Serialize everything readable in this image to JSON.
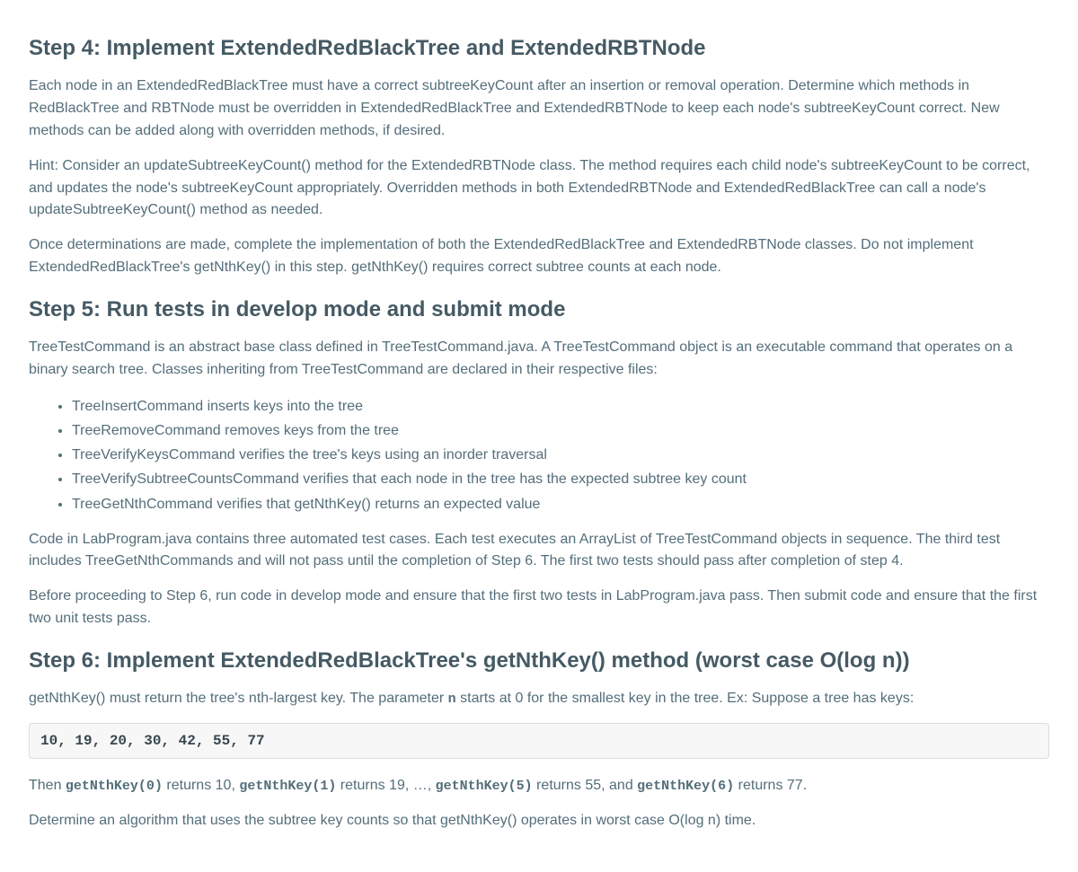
{
  "step4": {
    "heading": "Step 4: Implement ExtendedRedBlackTree and ExtendedRBTNode",
    "p1": "Each node in an ExtendedRedBlackTree must have a correct subtreeKeyCount after an insertion or removal operation. Determine which methods in RedBlackTree and RBTNode must be overridden in ExtendedRedBlackTree and ExtendedRBTNode to keep each node's subtreeKeyCount correct. New methods can be added along with overridden methods, if desired.",
    "p2": "Hint: Consider an updateSubtreeKeyCount() method for the ExtendedRBTNode class. The method requires each child node's subtreeKeyCount to be correct, and updates the node's subtreeKeyCount appropriately. Overridden methods in both ExtendedRBTNode and ExtendedRedBlackTree can call a node's updateSubtreeKeyCount() method as needed.",
    "p3": "Once determinations are made, complete the implementation of both the ExtendedRedBlackTree and ExtendedRBTNode classes. Do not implement ExtendedRedBlackTree's getNthKey() in this step. getNthKey() requires correct subtree counts at each node."
  },
  "step5": {
    "heading": "Step 5: Run tests in develop mode and submit mode",
    "p1": "TreeTestCommand is an abstract base class defined in TreeTestCommand.java. A TreeTestCommand object is an executable command that operates on a binary search tree. Classes inheriting from TreeTestCommand are declared in their respective files:",
    "bullets": [
      "TreeInsertCommand inserts keys into the tree",
      "TreeRemoveCommand removes keys from the tree",
      "TreeVerifyKeysCommand verifies the tree's keys using an inorder traversal",
      "TreeVerifySubtreeCountsCommand verifies that each node in the tree has the expected subtree key count",
      "TreeGetNthCommand verifies that getNthKey() returns an expected value"
    ],
    "p2": "Code in LabProgram.java contains three automated test cases. Each test executes an ArrayList of TreeTestCommand objects in sequence. The third test includes TreeGetNthCommands and will not pass until the completion of Step 6. The first two tests should pass after completion of step 4.",
    "p3": "Before proceeding to Step 6, run code in develop mode and ensure that the first two tests in LabProgram.java pass. Then submit code and ensure that the first two unit tests pass."
  },
  "step6": {
    "heading": "Step 6: Implement ExtendedRedBlackTree's getNthKey() method (worst case O(log n))",
    "p1_pre": "getNthKey() must return the tree's nth-largest key. The parameter ",
    "p1_code": "n",
    "p1_post": " starts at 0 for the smallest key in the tree. Ex: Suppose a tree has keys:",
    "codeblock": "10, 19, 20, 30, 42, 55, 77",
    "p2_t0": "Then ",
    "p2_c0": "getNthKey(0)",
    "p2_t1": " returns 10, ",
    "p2_c1": "getNthKey(1)",
    "p2_t2": " returns 19, …, ",
    "p2_c2": "getNthKey(5)",
    "p2_t3": " returns 55, and ",
    "p2_c3": "getNthKey(6)",
    "p2_t4": " returns 77.",
    "p3": "Determine an algorithm that uses the subtree key counts so that getNthKey() operates in worst case O(log n) time."
  }
}
